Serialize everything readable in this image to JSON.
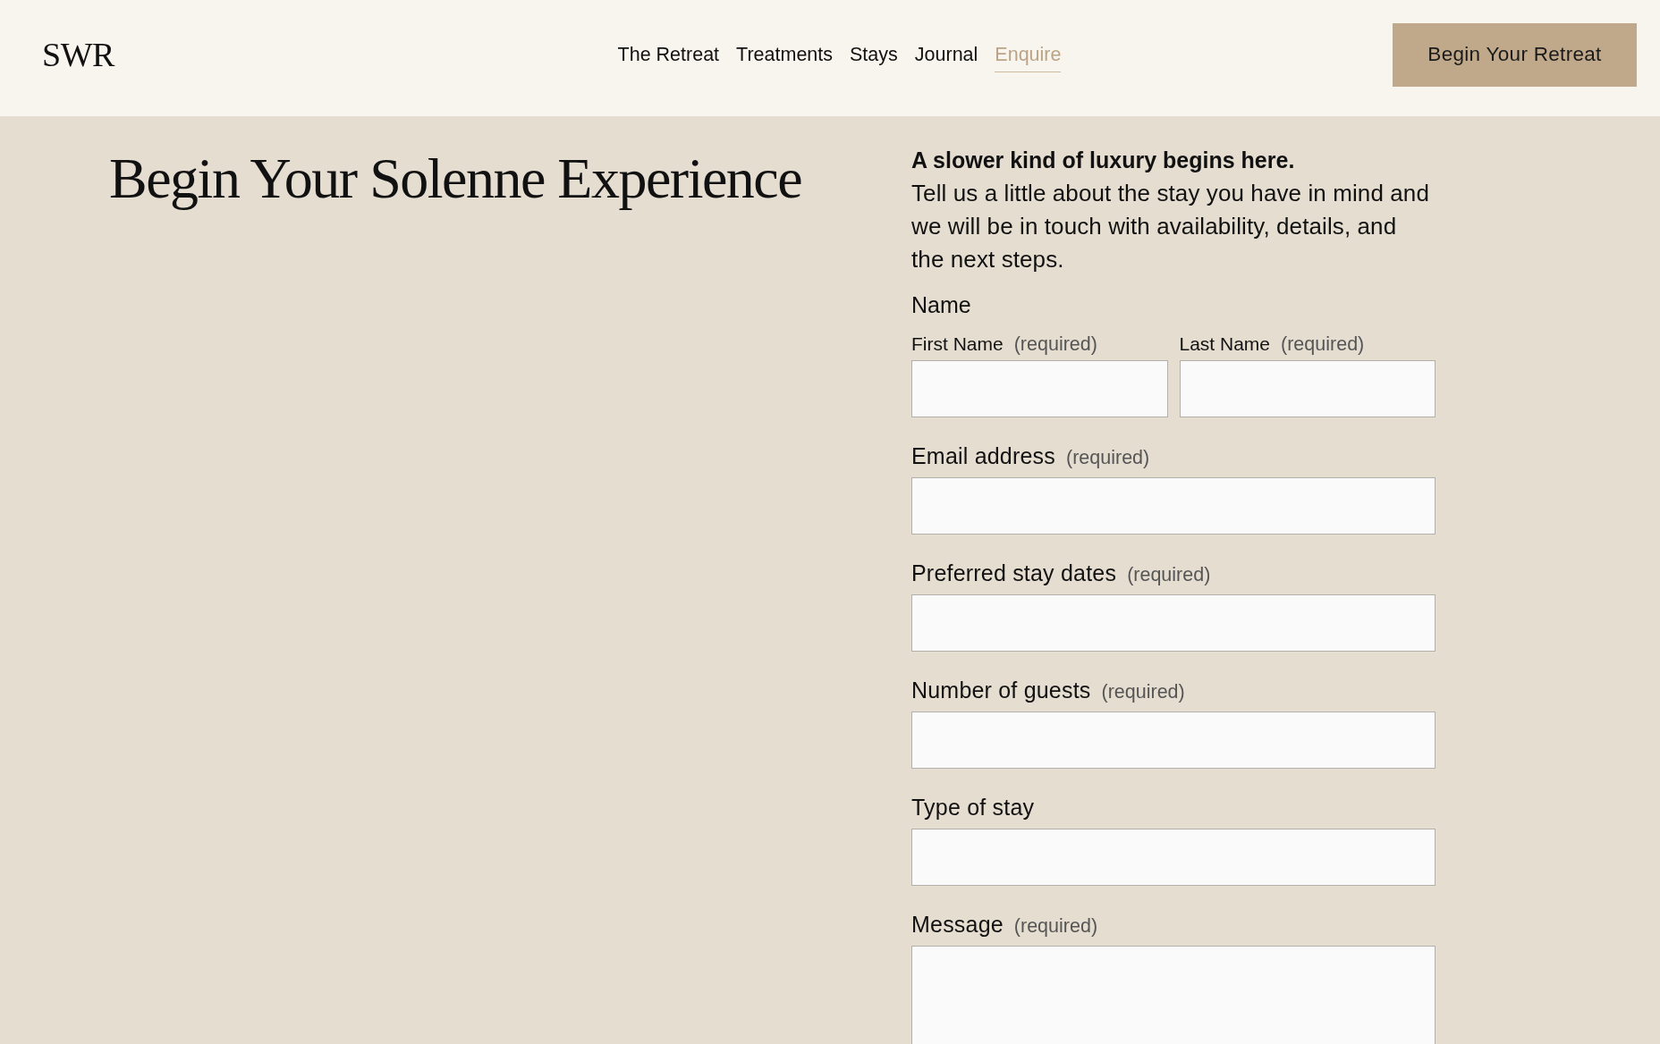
{
  "header": {
    "logo": "SWR",
    "nav": [
      {
        "label": "The Retreat",
        "selected": false
      },
      {
        "label": "Treatments",
        "selected": false
      },
      {
        "label": "Stays",
        "selected": false
      },
      {
        "label": "Journal",
        "selected": false
      },
      {
        "label": "Enquire",
        "selected": true
      }
    ],
    "cta": "Begin Your Retreat"
  },
  "hero": {
    "title": "Begin Your Solenne Experience"
  },
  "intro": {
    "lead": "A slower kind of luxury begins here.",
    "body": "Tell us a little about the stay you have in mind and we will be in touch with availability, details, and the next steps."
  },
  "form": {
    "fields": [
      {
        "kind": "name-group",
        "label": "Name",
        "parts": [
          {
            "label": "First Name",
            "note": "(required)"
          },
          {
            "label": "Last Name",
            "note": "(required)"
          }
        ]
      },
      {
        "kind": "text",
        "label": "Email address",
        "note": "(required)"
      },
      {
        "kind": "text",
        "label": "Preferred stay dates",
        "note": "(required)"
      },
      {
        "kind": "text",
        "label": "Number of guests",
        "note": "(required)"
      },
      {
        "kind": "text",
        "label": "Type of stay"
      },
      {
        "kind": "textarea",
        "label": "Message",
        "note": "(required)"
      }
    ]
  }
}
